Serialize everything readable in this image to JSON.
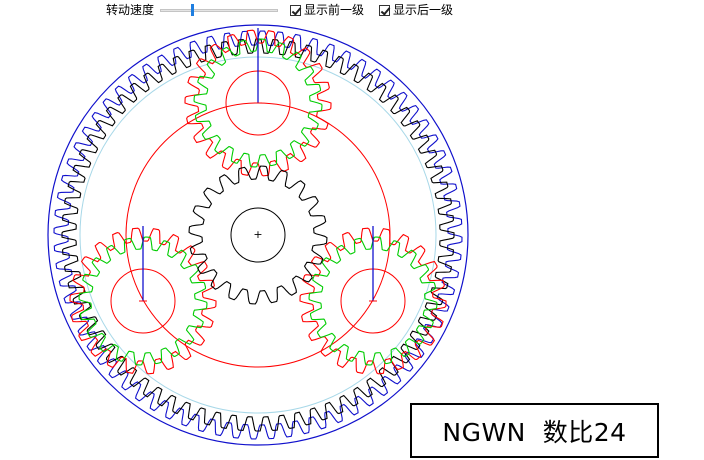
{
  "toolbar": {
    "speed_label": "转动速度",
    "speed_value_fraction": 0.27,
    "show_front_stage_label": "显示前一级",
    "show_front_stage_checked": true,
    "show_back_stage_label": "显示后一级",
    "show_back_stage_checked": true
  },
  "gear_view": {
    "center_marker": "+",
    "colors": {
      "outer_ring": "#1010cc",
      "ring_gear": "#000000",
      "ring_pitch": "#a8d8e8",
      "sun_gear": "#000000",
      "planet_gear_a": "#ff0000",
      "planet_gear_b": "#00cc00",
      "carrier": "#ff0000",
      "planet_axis": "#0000cc"
    }
  },
  "ratio_box": {
    "text": "NGWN  数比24"
  }
}
